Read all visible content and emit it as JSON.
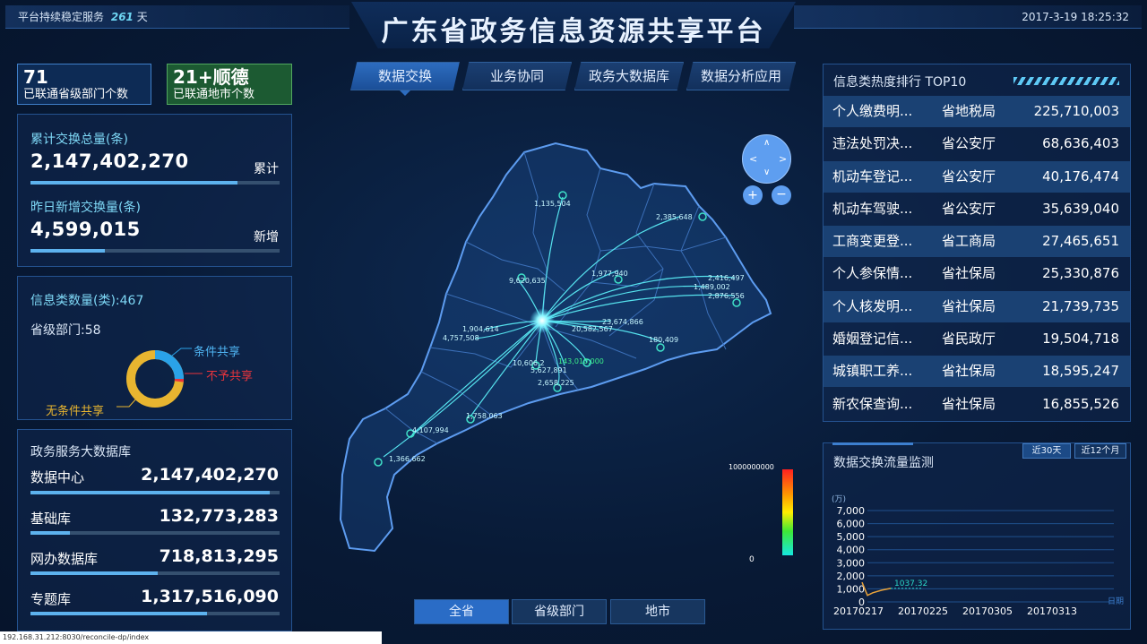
{
  "header": {
    "uptime_label": "平台持续稳定服务",
    "uptime_days": "261",
    "uptime_unit": "天",
    "title": "广东省政务信息资源共享平台",
    "datetime": "2017-3-19 18:25:32"
  },
  "stats": [
    {
      "value": "71",
      "label": "已联通省级部门个数"
    },
    {
      "value": "21+顺德",
      "label": "已联通地市个数"
    }
  ],
  "exchange": {
    "total_label": "累计交换总量(条)",
    "total_value": "2,147,402,270",
    "total_tag": "累计",
    "total_bar": 0.83,
    "new_label": "昨日新增交换量(条)",
    "new_value": "4,599,015",
    "new_tag": "新增",
    "new_bar": 0.3
  },
  "info_types": {
    "title": "信息类数量(类):467",
    "dept": "省级部门:58",
    "legend": [
      "条件共享",
      "不予共享",
      "无条件共享"
    ],
    "donut": {
      "conditional": 0.25,
      "no_share": 0.01,
      "unconditional": 0.74
    },
    "colors": {
      "conditional": "#2aa2e8",
      "no_share": "#e8343c",
      "unconditional": "#e8b530"
    }
  },
  "bigdata": {
    "title": "政务服务大数据库",
    "rows": [
      {
        "label": "数据中心",
        "value": "2,147,402,270",
        "bar": 0.96
      },
      {
        "label": "基础库",
        "value": "132,773,283",
        "bar": 0.16
      },
      {
        "label": "网办数据库",
        "value": "718,813,295",
        "bar": 0.51
      },
      {
        "label": "专题库",
        "value": "1,317,516,090",
        "bar": 0.71
      }
    ]
  },
  "tabs": [
    "数据交换",
    "业务协同",
    "政务大数据库",
    "数据分析应用"
  ],
  "bottom_tabs": [
    "全省",
    "省级部门",
    "地市"
  ],
  "map": {
    "labels": [
      "1,135,504",
      "2,385,648",
      "9,620,635",
      "1,977,940",
      "2,416,497",
      "1,489,002",
      "2,876,556",
      "1,904,614",
      "4,757,508",
      "23,674,866",
      "20,582,567",
      "180,409",
      "10,606,2",
      "5,627,891",
      "2,658,225",
      "143,010,000",
      "1,758,063",
      "4,107,994",
      "1,366,662"
    ],
    "scale_max": "1000000000",
    "scale_min": "0"
  },
  "ranking": {
    "title": "信息类热度排行 TOP10",
    "rows": [
      {
        "name": "个人缴费明...",
        "dept": "省地税局",
        "value": "225,710,003"
      },
      {
        "name": "违法处罚决...",
        "dept": "省公安厅",
        "value": "68,636,403"
      },
      {
        "name": "机动车登记...",
        "dept": "省公安厅",
        "value": "40,176,474"
      },
      {
        "name": "机动车驾驶...",
        "dept": "省公安厅",
        "value": "35,639,040"
      },
      {
        "name": "工商变更登...",
        "dept": "省工商局",
        "value": "27,465,651"
      },
      {
        "name": "个人参保情...",
        "dept": "省社保局",
        "value": "25,330,876"
      },
      {
        "name": "个人核发明...",
        "dept": "省社保局",
        "value": "21,739,735"
      },
      {
        "name": "婚姻登记信...",
        "dept": "省民政厅",
        "value": "19,504,718"
      },
      {
        "name": "城镇职工养...",
        "dept": "省社保局",
        "value": "18,595,247"
      },
      {
        "name": "新农保查询...",
        "dept": "省社保局",
        "value": "16,855,526"
      }
    ]
  },
  "traffic": {
    "title": "数据交换流量监测",
    "buttons": [
      "近30天",
      "近12个月"
    ]
  },
  "chart_data": {
    "type": "line",
    "ylabel": "(万)",
    "xlabel": "日期",
    "ylim": [
      0,
      7000
    ],
    "yticks": [
      "7,000",
      "6,000",
      "5,000",
      "4,000",
      "3,000",
      "2,000",
      "1,000",
      "0"
    ],
    "categories": [
      "20170217",
      "20170225",
      "20170305",
      "20170313"
    ],
    "series": [
      {
        "values": [
          1500,
          500,
          700,
          900,
          1037.32
        ]
      }
    ],
    "annotation": "1037.32",
    "color": "#e8a23a"
  },
  "status_url": "192.168.31.212:8030/reconcile-dp/index"
}
